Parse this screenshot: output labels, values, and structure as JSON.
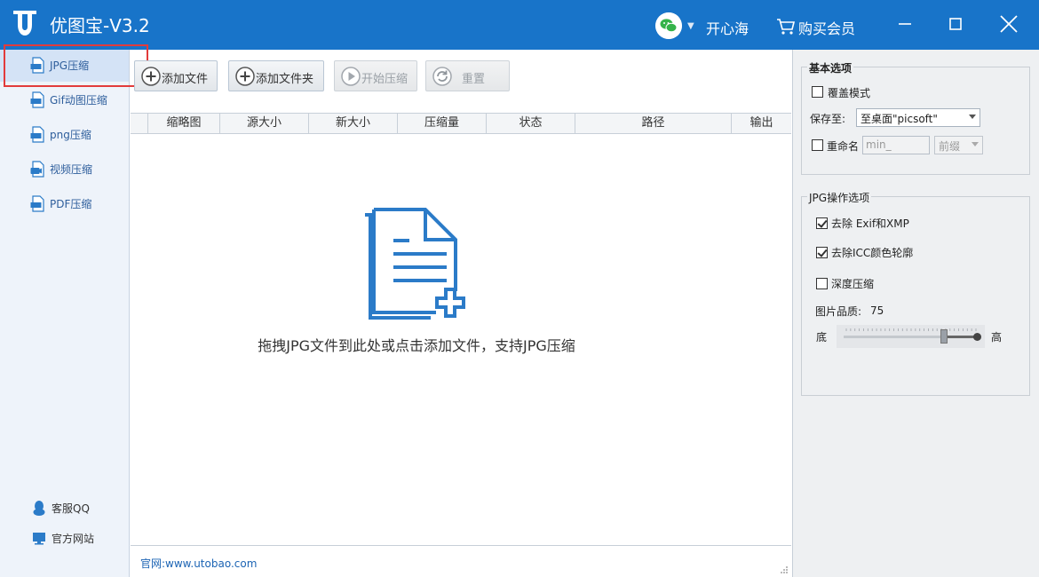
{
  "app": {
    "title": "优图宝-V3.2"
  },
  "header": {
    "user_name": "开心海",
    "buy_label": "购买会员"
  },
  "sidebar": {
    "items": [
      {
        "label": "JPG压缩",
        "icon": "jpg-file-icon",
        "active": true
      },
      {
        "label": "Gif动图压缩",
        "icon": "gif-file-icon",
        "active": false
      },
      {
        "label": "png压缩",
        "icon": "png-file-icon",
        "active": false
      },
      {
        "label": "视频压缩",
        "icon": "video-file-icon",
        "active": false
      },
      {
        "label": "PDF压缩",
        "icon": "pdf-file-icon",
        "active": false
      }
    ],
    "bottom": [
      {
        "label": "客服QQ",
        "icon": "qq-penguin-icon"
      },
      {
        "label": "官方网站",
        "icon": "monitor-icon"
      }
    ]
  },
  "toolbar": {
    "add_file": "添加文件",
    "add_folder": "添加文件夹",
    "start": "开始压缩",
    "reset": "重置"
  },
  "table": {
    "columns": [
      "缩略图",
      "源大小",
      "新大小",
      "压缩量",
      "状态",
      "路径",
      "输出"
    ],
    "empty_hint": "拖拽JPG文件到此处或点击添加文件，支持JPG压缩"
  },
  "footer": {
    "site": "官网:www.utobao.com"
  },
  "basic_options": {
    "title": "基本选项",
    "overwrite_label": "覆盖模式",
    "overwrite_checked": false,
    "save_to_label": "保存至:",
    "save_to_value": "至桌面\"picsoft\"",
    "rename_label": "重命名",
    "rename_checked": false,
    "rename_value": "min_",
    "rename_pos": "前缀"
  },
  "jpg_options": {
    "title": "JPG操作选项",
    "remove_exif_label": "去除 Exif和XMP",
    "remove_exif_checked": true,
    "remove_icc_label": "去除ICC颜色轮廓",
    "remove_icc_checked": true,
    "deep_label": "深度压缩",
    "deep_checked": false,
    "quality_label": "图片品质:",
    "quality_value": "75",
    "low_label": "底",
    "high_label": "高"
  },
  "colors": {
    "accent": "#1874c9",
    "highlight_box": "#e23b3b",
    "icon_blue": "#2b7bc8"
  }
}
